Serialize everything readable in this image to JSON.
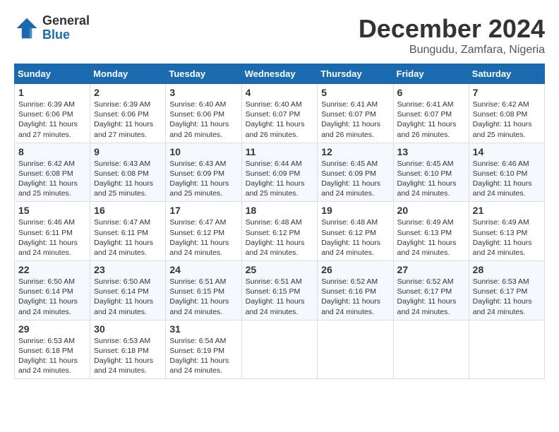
{
  "logo": {
    "general": "General",
    "blue": "Blue"
  },
  "title": {
    "month": "December 2024",
    "location": "Bungudu, Zamfara, Nigeria"
  },
  "headers": [
    "Sunday",
    "Monday",
    "Tuesday",
    "Wednesday",
    "Thursday",
    "Friday",
    "Saturday"
  ],
  "weeks": [
    [
      {
        "day": "1",
        "sunrise": "6:39 AM",
        "sunset": "6:06 PM",
        "daylight": "11 hours and 27 minutes."
      },
      {
        "day": "2",
        "sunrise": "6:39 AM",
        "sunset": "6:06 PM",
        "daylight": "11 hours and 27 minutes."
      },
      {
        "day": "3",
        "sunrise": "6:40 AM",
        "sunset": "6:06 PM",
        "daylight": "11 hours and 26 minutes."
      },
      {
        "day": "4",
        "sunrise": "6:40 AM",
        "sunset": "6:07 PM",
        "daylight": "11 hours and 26 minutes."
      },
      {
        "day": "5",
        "sunrise": "6:41 AM",
        "sunset": "6:07 PM",
        "daylight": "11 hours and 26 minutes."
      },
      {
        "day": "6",
        "sunrise": "6:41 AM",
        "sunset": "6:07 PM",
        "daylight": "11 hours and 26 minutes."
      },
      {
        "day": "7",
        "sunrise": "6:42 AM",
        "sunset": "6:08 PM",
        "daylight": "11 hours and 25 minutes."
      }
    ],
    [
      {
        "day": "8",
        "sunrise": "6:42 AM",
        "sunset": "6:08 PM",
        "daylight": "11 hours and 25 minutes."
      },
      {
        "day": "9",
        "sunrise": "6:43 AM",
        "sunset": "6:08 PM",
        "daylight": "11 hours and 25 minutes."
      },
      {
        "day": "10",
        "sunrise": "6:43 AM",
        "sunset": "6:09 PM",
        "daylight": "11 hours and 25 minutes."
      },
      {
        "day": "11",
        "sunrise": "6:44 AM",
        "sunset": "6:09 PM",
        "daylight": "11 hours and 25 minutes."
      },
      {
        "day": "12",
        "sunrise": "6:45 AM",
        "sunset": "6:09 PM",
        "daylight": "11 hours and 24 minutes."
      },
      {
        "day": "13",
        "sunrise": "6:45 AM",
        "sunset": "6:10 PM",
        "daylight": "11 hours and 24 minutes."
      },
      {
        "day": "14",
        "sunrise": "6:46 AM",
        "sunset": "6:10 PM",
        "daylight": "11 hours and 24 minutes."
      }
    ],
    [
      {
        "day": "15",
        "sunrise": "6:46 AM",
        "sunset": "6:11 PM",
        "daylight": "11 hours and 24 minutes."
      },
      {
        "day": "16",
        "sunrise": "6:47 AM",
        "sunset": "6:11 PM",
        "daylight": "11 hours and 24 minutes."
      },
      {
        "day": "17",
        "sunrise": "6:47 AM",
        "sunset": "6:12 PM",
        "daylight": "11 hours and 24 minutes."
      },
      {
        "day": "18",
        "sunrise": "6:48 AM",
        "sunset": "6:12 PM",
        "daylight": "11 hours and 24 minutes."
      },
      {
        "day": "19",
        "sunrise": "6:48 AM",
        "sunset": "6:12 PM",
        "daylight": "11 hours and 24 minutes."
      },
      {
        "day": "20",
        "sunrise": "6:49 AM",
        "sunset": "6:13 PM",
        "daylight": "11 hours and 24 minutes."
      },
      {
        "day": "21",
        "sunrise": "6:49 AM",
        "sunset": "6:13 PM",
        "daylight": "11 hours and 24 minutes."
      }
    ],
    [
      {
        "day": "22",
        "sunrise": "6:50 AM",
        "sunset": "6:14 PM",
        "daylight": "11 hours and 24 minutes."
      },
      {
        "day": "23",
        "sunrise": "6:50 AM",
        "sunset": "6:14 PM",
        "daylight": "11 hours and 24 minutes."
      },
      {
        "day": "24",
        "sunrise": "6:51 AM",
        "sunset": "6:15 PM",
        "daylight": "11 hours and 24 minutes."
      },
      {
        "day": "25",
        "sunrise": "6:51 AM",
        "sunset": "6:15 PM",
        "daylight": "11 hours and 24 minutes."
      },
      {
        "day": "26",
        "sunrise": "6:52 AM",
        "sunset": "6:16 PM",
        "daylight": "11 hours and 24 minutes."
      },
      {
        "day": "27",
        "sunrise": "6:52 AM",
        "sunset": "6:17 PM",
        "daylight": "11 hours and 24 minutes."
      },
      {
        "day": "28",
        "sunrise": "6:53 AM",
        "sunset": "6:17 PM",
        "daylight": "11 hours and 24 minutes."
      }
    ],
    [
      {
        "day": "29",
        "sunrise": "6:53 AM",
        "sunset": "6:18 PM",
        "daylight": "11 hours and 24 minutes."
      },
      {
        "day": "30",
        "sunrise": "6:53 AM",
        "sunset": "6:18 PM",
        "daylight": "11 hours and 24 minutes."
      },
      {
        "day": "31",
        "sunrise": "6:54 AM",
        "sunset": "6:19 PM",
        "daylight": "11 hours and 24 minutes."
      },
      null,
      null,
      null,
      null
    ]
  ]
}
